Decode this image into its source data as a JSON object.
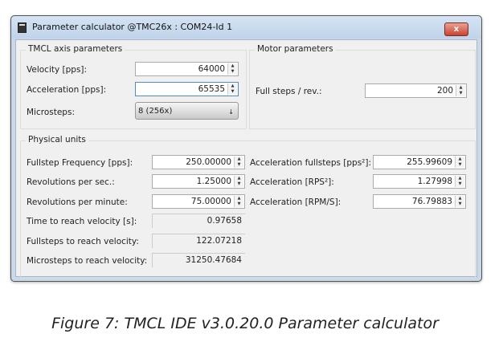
{
  "window": {
    "title": "Parameter calculator @TMC26x : COM24-Id 1",
    "close_label": "x"
  },
  "tmcl": {
    "title": "TMCL axis parameters",
    "velocity_label": "Velocity [pps]:",
    "velocity": "64000",
    "acceleration_label": "Acceleration [pps]:",
    "acceleration": "65535",
    "microsteps_label": "Microsteps:",
    "microsteps": "8 (256x)"
  },
  "motor": {
    "title": "Motor parameters",
    "fullsteps_label": "Full steps / rev.:",
    "fullsteps": "200"
  },
  "physical": {
    "title": "Physical units",
    "rows": [
      {
        "label": "Fullstep Frequency [pps]:",
        "value": "250.00000",
        "label2": "Acceleration fullsteps [pps²]:",
        "value2": "255.99609"
      },
      {
        "label": "Revolutions per sec.:",
        "value": "1.25000",
        "label2": "Acceleration [RPS²]:",
        "value2": "1.27998"
      },
      {
        "label": "Revolutions per minute:",
        "value": "75.00000",
        "label2": "Acceleration [RPM/S]:",
        "value2": "76.79883"
      },
      {
        "label": "Time to reach velocity [s]:",
        "value": "0.97658"
      },
      {
        "label": "Fullsteps to reach velocity:",
        "value": "122.07218"
      },
      {
        "label": "Microsteps to reach velocity:",
        "value": "31250.47684"
      }
    ]
  },
  "caption": "Figure 7: TMCL IDE v3.0.20.0 Parameter calculator"
}
